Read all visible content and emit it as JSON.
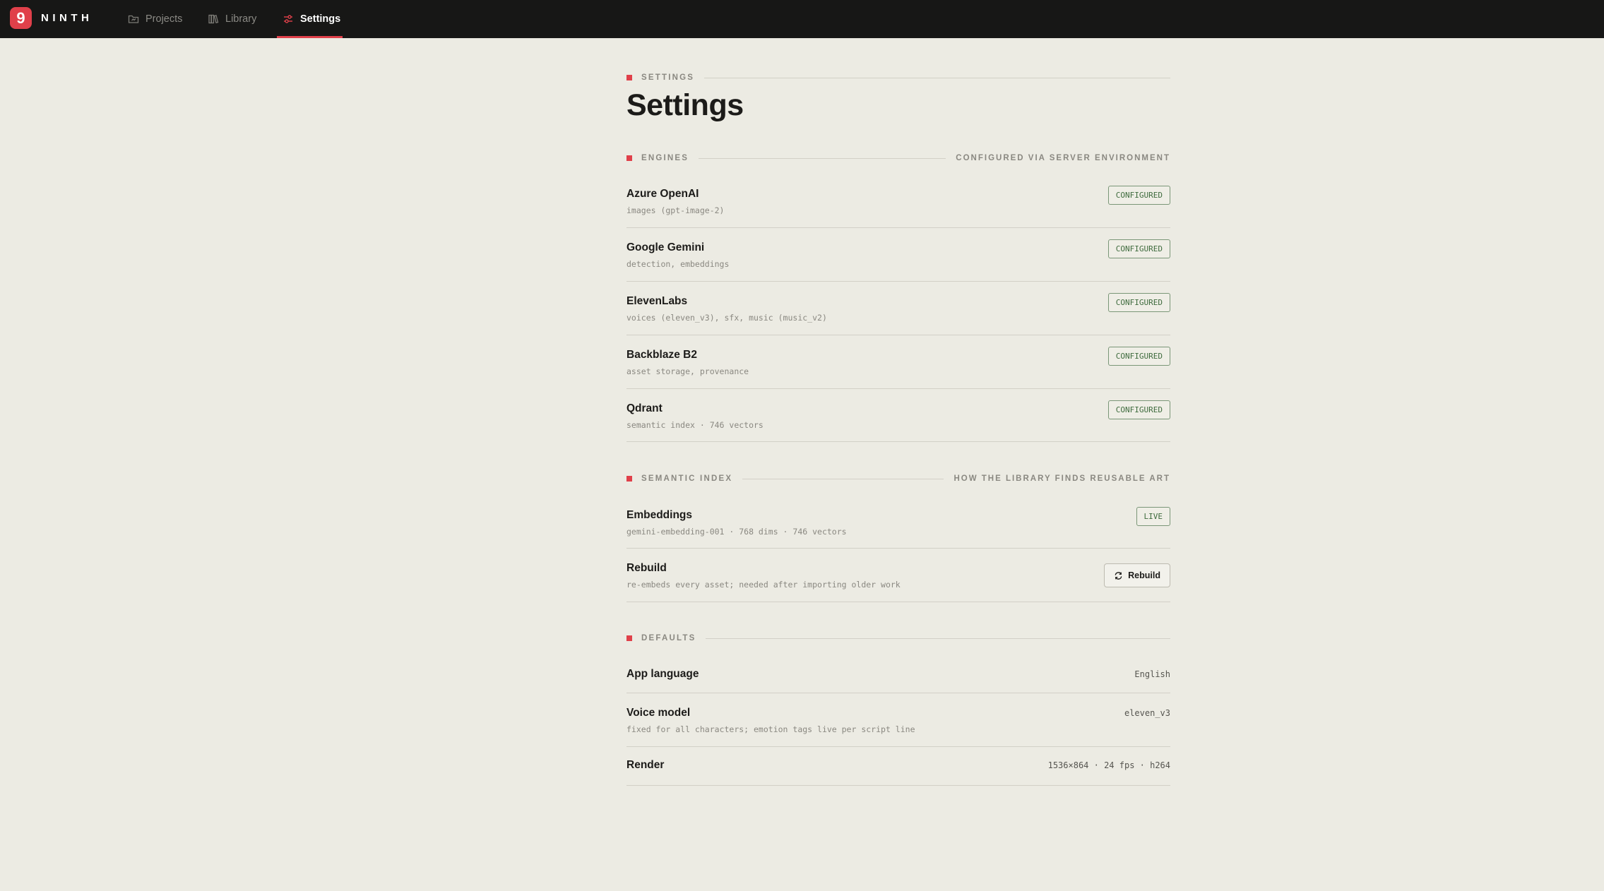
{
  "app": {
    "logo_glyph": "9",
    "name": "NINTH",
    "accent": "#e0404a"
  },
  "nav": {
    "projects": {
      "label": "Projects",
      "icon": "folder-icon"
    },
    "library": {
      "label": "Library",
      "icon": "books-icon"
    },
    "settings": {
      "label": "Settings",
      "icon": "sliders-icon",
      "active": true
    }
  },
  "page": {
    "eyebrow": "SETTINGS",
    "title": "Settings"
  },
  "engines": {
    "label": "ENGINES",
    "note": "CONFIGURED VIA SERVER ENVIRONMENT",
    "items": [
      {
        "title": "Azure OpenAI",
        "sub": "images (gpt-image-2)",
        "status": "CONFIGURED"
      },
      {
        "title": "Google Gemini",
        "sub": "detection, embeddings",
        "status": "CONFIGURED"
      },
      {
        "title": "ElevenLabs",
        "sub": "voices (eleven_v3), sfx, music (music_v2)",
        "status": "CONFIGURED"
      },
      {
        "title": "Backblaze B2",
        "sub": "asset storage, provenance",
        "status": "CONFIGURED"
      },
      {
        "title": "Qdrant",
        "sub": "semantic index · 746 vectors",
        "status": "CONFIGURED"
      }
    ]
  },
  "semantic": {
    "label": "SEMANTIC INDEX",
    "note": "HOW THE LIBRARY FINDS REUSABLE ART",
    "embeddings": {
      "title": "Embeddings",
      "sub": "gemini-embedding-001 · 768 dims · 746 vectors",
      "status": "LIVE"
    },
    "rebuild": {
      "title": "Rebuild",
      "sub": "re-embeds every asset; needed after importing older work",
      "button": "Rebuild"
    }
  },
  "defaults": {
    "label": "DEFAULTS",
    "language": {
      "title": "App language",
      "value": "English"
    },
    "voice": {
      "title": "Voice model",
      "sub": "fixed for all characters; emotion tags live per script line",
      "value": "eleven_v3"
    },
    "render": {
      "title": "Render",
      "value": "1536×864 · 24 fps · h264"
    }
  }
}
